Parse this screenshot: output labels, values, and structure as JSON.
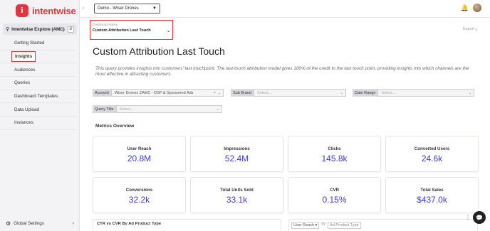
{
  "brand": {
    "logo_letter": "i",
    "name": "intentwise"
  },
  "sidebar": {
    "explore_label": "Intentwise Explore (AMC)",
    "items": [
      {
        "label": "Getting Started"
      },
      {
        "label": "Insights"
      },
      {
        "label": "Audiences"
      },
      {
        "label": "Queries"
      },
      {
        "label": "Dashboard Templates"
      },
      {
        "label": "Data Upload"
      },
      {
        "label": "Instances"
      }
    ],
    "global_settings": "Global Settings"
  },
  "topbar": {
    "account_select": "Demo - Wiser Drones"
  },
  "dashboard": {
    "name_label": "Dashboard Name",
    "name_value": "Custom Attribution Last Touch",
    "export_label": "Export",
    "title": "Custom Attribution Last Touch",
    "description": "This query provides insights into customers' last touchpoint. The last-touch attribution model gives 100% of the credit to the last touch point, providing insights into which channels are the most effective in attracting customers."
  },
  "filters": {
    "account_label": "Account",
    "account_value": "Wiser Drones ZAMC - DSP & Sponsored Ads",
    "sub_brand_label": "Sub Brand",
    "sub_brand_placeholder": "Select...",
    "date_range_label": "Date Range",
    "date_range_placeholder": "Select...",
    "query_title_label": "Query Title",
    "query_title_placeholder": "Select..."
  },
  "metrics": {
    "title": "Metrics Overview",
    "cards": [
      {
        "label": "User Reach",
        "value": "20.8M"
      },
      {
        "label": "Impressions",
        "value": "52.4M"
      },
      {
        "label": "Clicks",
        "value": "145.8k"
      },
      {
        "label": "Converted Users",
        "value": "24.6k"
      },
      {
        "label": "Conversions",
        "value": "32.2k"
      },
      {
        "label": "Total Units Sold",
        "value": "33.1k"
      },
      {
        "label": "CVR",
        "value": "0.15%"
      },
      {
        "label": "Total Sales",
        "value": "$437.0k"
      }
    ]
  },
  "bottom": {
    "left_title": "CTR vs CVR By Ad Product Type",
    "metric_select": "User Reach",
    "by_label": "by",
    "dimension_select": "Ad Product Type"
  },
  "colors": {
    "accent": "#e5343d",
    "metric_value": "#3b3fd8",
    "highlight": "#e53935"
  }
}
